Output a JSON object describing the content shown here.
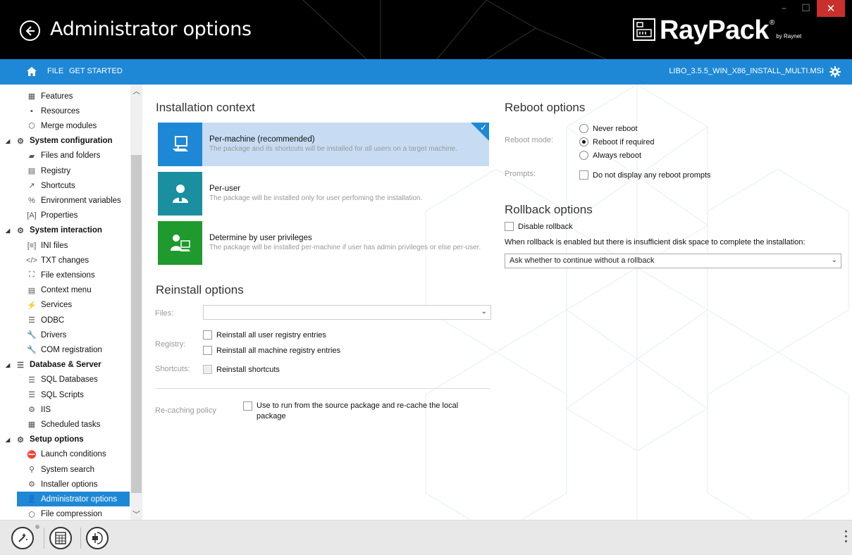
{
  "title_bar": {
    "title": "Administrator options",
    "logo_text": "RayPack",
    "logo_reg": "®",
    "logo_by": "by Raynet",
    "minimize_label": "–",
    "maximize_label": "☐",
    "close_label": "✕"
  },
  "ribbon": {
    "file_label": "FILE",
    "get_started_label": "GET STARTED",
    "package_name": "LIBO_3.5.5_WIN_X86_INSTALL_MULTI.MSI"
  },
  "sidebar": {
    "items": [
      {
        "label": "Features",
        "icon": "features-icon",
        "glyph": "▦"
      },
      {
        "label": "Resources",
        "icon": "resources-icon",
        "glyph": "▪"
      },
      {
        "label": "Merge modules",
        "icon": "merge-modules-icon",
        "glyph": "⬡"
      },
      {
        "label": "System configuration",
        "icon": "system-configuration-icon",
        "glyph": "⚙"
      },
      {
        "label": "Files and folders",
        "icon": "folder-icon",
        "glyph": "▰"
      },
      {
        "label": "Registry",
        "icon": "registry-icon",
        "glyph": "▤"
      },
      {
        "label": "Shortcuts",
        "icon": "shortcut-icon",
        "glyph": "↗"
      },
      {
        "label": "Environment variables",
        "icon": "percent-icon",
        "glyph": "%"
      },
      {
        "label": "Properties",
        "icon": "properties-icon",
        "glyph": "[A]"
      },
      {
        "label": "System interaction",
        "icon": "system-interaction-icon",
        "glyph": "⚙"
      },
      {
        "label": "INI files",
        "icon": "ini-files-icon",
        "glyph": "[≡]"
      },
      {
        "label": "TXT changes",
        "icon": "code-icon",
        "glyph": "</>"
      },
      {
        "label": "File extensions",
        "icon": "file-extensions-icon",
        "glyph": "⛶"
      },
      {
        "label": "Context menu",
        "icon": "context-menu-icon",
        "glyph": "▤"
      },
      {
        "label": "Services",
        "icon": "services-icon",
        "glyph": "⚡"
      },
      {
        "label": "ODBC",
        "icon": "database-icon",
        "glyph": "☰"
      },
      {
        "label": "Drivers",
        "icon": "wrench-icon",
        "glyph": "🔧"
      },
      {
        "label": "COM registration",
        "icon": "wrench-icon",
        "glyph": "🔧"
      },
      {
        "label": "Database & Server",
        "icon": "server-icon",
        "glyph": "☰"
      },
      {
        "label": "SQL Databases",
        "icon": "database-icon",
        "glyph": "☰"
      },
      {
        "label": "SQL Scripts",
        "icon": "database-icon",
        "glyph": "☰"
      },
      {
        "label": "IIS",
        "icon": "iis-icon",
        "glyph": "⚙"
      },
      {
        "label": "Scheduled tasks",
        "icon": "scheduled-tasks-icon",
        "glyph": "▦"
      },
      {
        "label": "Setup options",
        "icon": "setup-options-icon",
        "glyph": "⚙"
      },
      {
        "label": "Launch conditions",
        "icon": "launch-conditions-icon",
        "glyph": "⛔"
      },
      {
        "label": "System search",
        "icon": "search-icon",
        "glyph": "⚲"
      },
      {
        "label": "Installer options",
        "icon": "installer-options-icon",
        "glyph": "⚙"
      },
      {
        "label": "Administrator options",
        "icon": "user-icon",
        "glyph": "👤"
      },
      {
        "label": "File compression",
        "icon": "file-compression-icon",
        "glyph": "⬡"
      }
    ]
  },
  "installation_context": {
    "title": "Installation context",
    "options": [
      {
        "title": "Per-machine (recommended)",
        "desc": "The package and its shortcuts will be installed for all users on a target machine."
      },
      {
        "title": "Per-user",
        "desc": "The package will be installed only for user perfoming the installation."
      },
      {
        "title": "Determine by user privileges",
        "desc": "The package will be installed per-machine if user has admin privileges or else per-user."
      }
    ]
  },
  "reinstall_options": {
    "title": "Reinstall options",
    "files_label": "Files:",
    "files_value": "",
    "registry_label": "Registry:",
    "reinstall_user_registry": "Reinstall all user registry entries",
    "reinstall_machine_registry": "Reinstall all machine registry entries",
    "shortcuts_label": "Shortcuts:",
    "reinstall_shortcuts": "Reinstall shortcuts",
    "recaching_label": "Re-caching policy",
    "recaching_option": "Use to run from the source package and re-cache the local package"
  },
  "reboot_options": {
    "title": "Reboot options",
    "mode_label": "Reboot mode:",
    "never": "Never reboot",
    "if_required": "Reboot if required",
    "always": "Always reboot",
    "prompts_label": "Prompts:",
    "no_prompts": "Do not display any reboot prompts"
  },
  "rollback_options": {
    "title": "Rollback options",
    "disable": "Disable rollback",
    "insufficient_label": "When rollback is enabled but there is insufficient disk space to complete the installation:",
    "insufficient_value": "Ask whether to continue without a rollback"
  },
  "colors": {
    "ribbon": "#1e88d6",
    "tile_machine": "#1e88d6",
    "tile_user": "#1a8fa0",
    "tile_privileges": "#1e9a2e",
    "selected_tile_bg": "#c7dcf3"
  }
}
